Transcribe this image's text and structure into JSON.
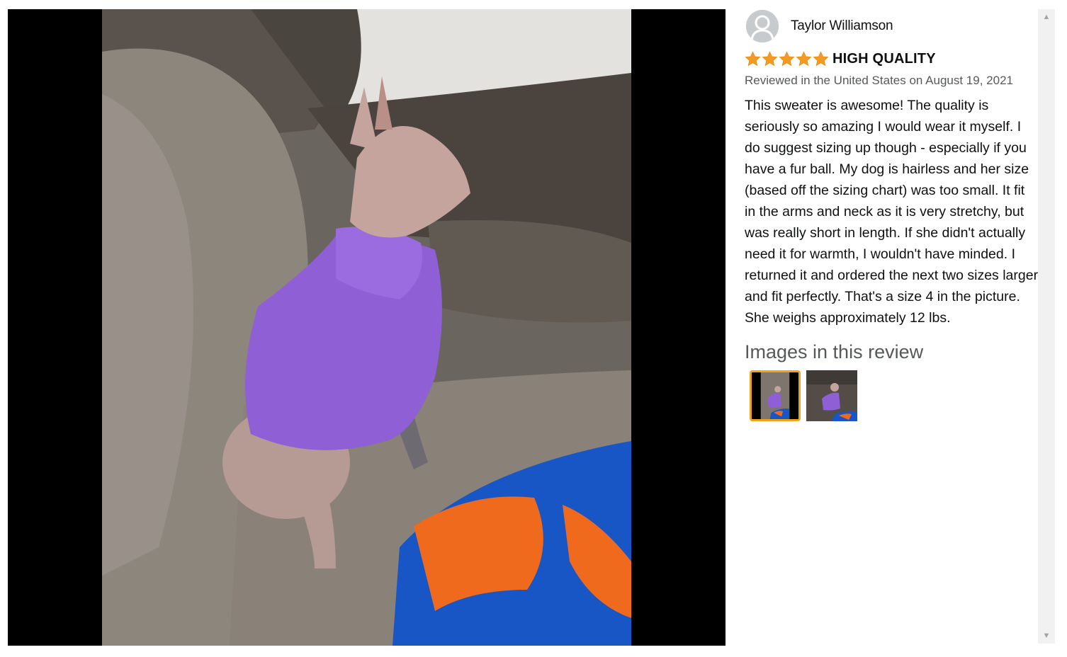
{
  "reviewer": {
    "name": "Taylor Williamson",
    "avatar_icon": "user-silhouette-icon"
  },
  "review": {
    "rating": 5,
    "rating_max": 5,
    "star_color": "#f59a23",
    "title": "HIGH QUALITY",
    "date": "Reviewed in the United States on August 19, 2021",
    "body": "This sweater is awesome! The quality is seriously so amazing I would wear it myself. I do suggest sizing up though - especially if you have a fur ball. My dog is hairless and her size (based off the sizing chart) was too small. It fit in the arms and neck as it is very stretchy, but was really short in length. If she didn't actually need it for warmth, I wouldn't have minded. I returned it and ordered the next two sizes larger and fit perfectly. That's a size 4 in the picture. She weighs approximately 12 lbs."
  },
  "images_section": {
    "heading": "Images in this review",
    "thumbnails": [
      {
        "selected": true,
        "highlight_color": "#f0a31e"
      },
      {
        "selected": false
      }
    ]
  },
  "scrollbar": {
    "up_icon": "triangle-up-icon",
    "down_icon": "triangle-down-icon"
  }
}
